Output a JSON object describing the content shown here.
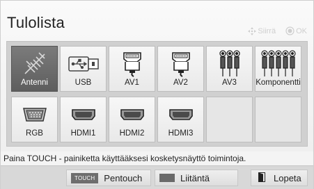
{
  "header": {
    "title": "Tulolista",
    "hint_move": "Siirrä",
    "hint_ok": "OK"
  },
  "inputs": [
    {
      "label": "Antenni",
      "icon": "antenna-icon",
      "selected": true
    },
    {
      "label": "USB",
      "icon": "usb-icon",
      "selected": false
    },
    {
      "label": "AV1",
      "icon": "scart-icon",
      "selected": false
    },
    {
      "label": "AV2",
      "icon": "scart-icon",
      "selected": false
    },
    {
      "label": "AV3",
      "icon": "rca-av-icon",
      "selected": false
    },
    {
      "label": "Komponentti",
      "icon": "component-icon",
      "selected": false
    },
    {
      "label": "RGB",
      "icon": "vga-icon",
      "selected": false
    },
    {
      "label": "HDMI1",
      "icon": "hdmi-icon",
      "selected": false
    },
    {
      "label": "HDMI2",
      "icon": "hdmi-icon",
      "selected": false
    },
    {
      "label": "HDMI3",
      "icon": "hdmi-icon",
      "selected": false
    }
  ],
  "status_text": "Paina TOUCH - painiketta käyttääksesi kosketysnäyttö toimintoja.",
  "footer": {
    "touch_badge": "TOUCH",
    "pentouch_label": "Pentouch",
    "link_label": "Liitäntä",
    "exit_label": "Lopeta"
  },
  "colors": {
    "selected_tile": "#6a6a6a",
    "panel": "#d0d0d0"
  }
}
